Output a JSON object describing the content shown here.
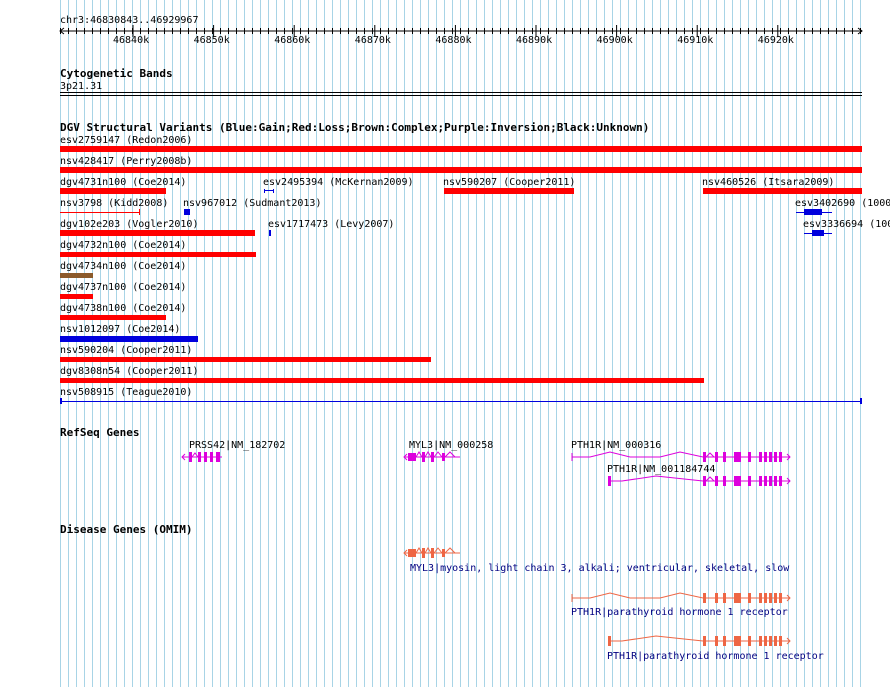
{
  "position": "chr3:46830843..46929967",
  "ruler": {
    "ticks": [
      "46840k",
      "46850k",
      "46860k",
      "46870k",
      "46880k",
      "46890k",
      "46900k",
      "46910k",
      "46920k"
    ]
  },
  "tracks": {
    "cyto": {
      "title": "Cytogenetic Bands",
      "band": "3p21.31"
    },
    "dgv": {
      "title": "DGV Structural Variants (Blue:Gain;Red:Loss;Brown:Complex;Purple:Inversion;Black:Unknown)",
      "labels": {
        "v01": "esv2759147 (Redon2006)",
        "v02": "nsv428417 (Perry2008b)",
        "v03": "dgv4731n100 (Coe2014)",
        "v04": "esv2495394 (McKernan2009)",
        "v05": "nsv590207 (Cooper2011)",
        "v06": "nsv460526 (Itsara2009)",
        "v07": "nsv3798 (Kidd2008)",
        "v08": "nsv967012 (Sudmant2013)",
        "v09": "esv3402690 (1000",
        "v10": "dgv102e203 (Vogler2010)",
        "v11": "esv1717473 (Levy2007)",
        "v12": "esv3336694 (100",
        "v13": "dgv4732n100 (Coe2014)",
        "v14": "dgv4734n100 (Coe2014)",
        "v15": "dgv4737n100 (Coe2014)",
        "v16": "dgv4738n100 (Coe2014)",
        "v17": "nsv1012097 (Coe2014)",
        "v18": "nsv590204 (Cooper2011)",
        "v19": "dgv8308n54 (Cooper2011)",
        "v20": "nsv508915 (Teague2010)"
      }
    },
    "refseq": {
      "title": "RefSeq Genes",
      "genes": {
        "g1": "PRSS42|NM_182702",
        "g2": "MYL3|NM_000258",
        "g3": "PTH1R|NM_000316",
        "g4": "PTH1R|NM_001184744"
      }
    },
    "omim": {
      "title": "Disease Genes (OMIM)",
      "genes": {
        "d1": "MYL3|myosin, light chain 3, alkali; ventricular, skeletal, slow",
        "d2": "PTH1R|parathyroid hormone 1 receptor",
        "d3": "PTH1R|parathyroid hormone 1 receptor"
      }
    }
  },
  "colors": {
    "loss": "#ff0000",
    "gain": "#0000dd",
    "complex": "#8b5a2b",
    "refseq": "#dd00dd",
    "omim": "#ee6644",
    "grid": "#a8d4e6"
  }
}
